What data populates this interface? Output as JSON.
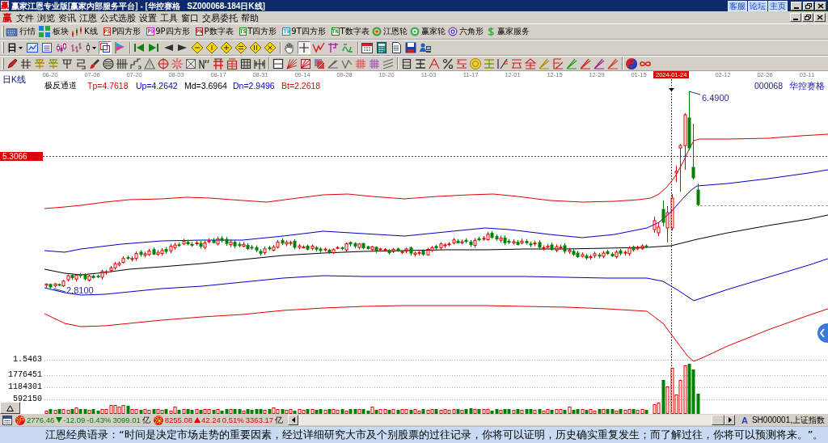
{
  "window": {
    "app_icon": "赢",
    "title": "赢家江恩专业版[赢家内部服务平台] - [华控赛格   SZ000068-184日K线]",
    "links": [
      "客服",
      "论坛",
      "主页"
    ]
  },
  "menu": {
    "logo": "赢",
    "items": [
      "文件",
      "浏览",
      "资讯",
      "江恩",
      "公式选股",
      "设置",
      "工具",
      "窗口",
      "交易委托",
      "帮助"
    ]
  },
  "toolbar_1": [
    {
      "kind": "icon",
      "label": "行情"
    },
    {
      "kind": "icon",
      "label": "板块"
    },
    {
      "kind": "icon",
      "label": "K线"
    },
    {
      "kind": "tag",
      "tag": "PS",
      "color": "#c03030",
      "label": "P四方形"
    },
    {
      "kind": "tag",
      "tag": "P9",
      "color": "#c020c0",
      "label": "9P四方形"
    },
    {
      "kind": "tag",
      "tag": "PN",
      "color": "#a02020",
      "label": "P数字表"
    },
    {
      "kind": "tag",
      "tag": "TS",
      "color": "#209020",
      "label": "T四方形"
    },
    {
      "kind": "tag",
      "tag": "T9",
      "color": "#1890b0",
      "label": "9T四方形"
    },
    {
      "kind": "tag",
      "tag": "TN",
      "color": "#208020",
      "label": "T数字表"
    },
    {
      "kind": "icon",
      "label": "江恩轮"
    },
    {
      "kind": "icon",
      "label": "赢家轮"
    },
    {
      "kind": "icon",
      "label": "六角形"
    },
    {
      "kind": "icon",
      "label": "赢家服务"
    }
  ],
  "toolbar_2": {
    "period": "日",
    "tools": [
      {
        "pressed": false
      },
      {
        "pressed": false
      },
      {
        "pressed": false
      },
      {
        "pressed": false
      },
      {
        "pressed": false
      },
      {
        "pressed": true
      },
      {
        "pressed": false
      },
      {
        "pressed": false
      },
      {
        "pressed": false
      },
      {
        "pressed": false
      },
      {
        "pressed": false
      },
      {
        "pressed": false
      },
      {
        "pressed": false
      },
      {
        "pressed": false
      },
      {
        "pressed": false
      },
      {
        "pressed": false
      },
      {
        "pressed": false
      },
      {
        "pressed": false
      },
      {
        "pressed": true
      },
      {
        "pressed": false
      },
      {
        "pressed": false
      },
      {
        "pressed": false
      },
      {
        "pressed": false
      },
      {
        "pressed": false
      },
      {
        "pressed": false
      },
      {
        "pressed": false
      },
      {
        "pressed": false
      }
    ]
  },
  "chart": {
    "dates": [
      "06-20",
      "07-06",
      "07-20",
      "08-03",
      "08-17",
      "08-31",
      "09-14",
      "09-28",
      "10-20",
      "11-03",
      "11-17",
      "12-01",
      "12-15",
      "12-29",
      "01-15"
    ],
    "cursor_date": "2024-01-24",
    "later_dates": [
      "02-12",
      "02-26",
      "03-11"
    ],
    "period": "日K线",
    "indicator": "极反通道",
    "params": [
      {
        "text": "Tp=4.7618",
        "color": "#e00000"
      },
      {
        "text": "Up=4.2642",
        "color": "#0000c8"
      },
      {
        "text": "Md=3.6964",
        "color": "#000000"
      },
      {
        "text": "Dn=2.9496",
        "color": "#0000c8"
      },
      {
        "text": "Bt=2.2618",
        "color": "#e00000"
      }
    ],
    "stock_code": "000068",
    "stock_name": "华控赛格",
    "cursor_price": "5.3066",
    "high_label": "6.4900",
    "low_label": "2.8100",
    "volume_labels": [
      "1.5463",
      "1776451",
      "1184301",
      "592150"
    ]
  },
  "status_bar": {
    "markets": [
      {
        "badge": "沪",
        "index": "2776.46",
        "rising": false,
        "change": "-12.09",
        "percent": "-0.43%",
        "amount": "3099.01",
        "unit": "亿"
      },
      {
        "badge": "深",
        "index": "8255.08",
        "rising": true,
        "change": "42.24",
        "percent": "0.51%",
        "amount": "3363.17",
        "unit": "亿"
      }
    ],
    "toggle": "A",
    "index_name": "SH000001,上证指数"
  },
  "quote": "江恩经典语录：“时间是决定市场走势的重要因素，经过详细研究大市及个别股票的过往记录，你将可以证明，历史确实重复发生；而了解过往，你将可以预测将来。”。"
}
